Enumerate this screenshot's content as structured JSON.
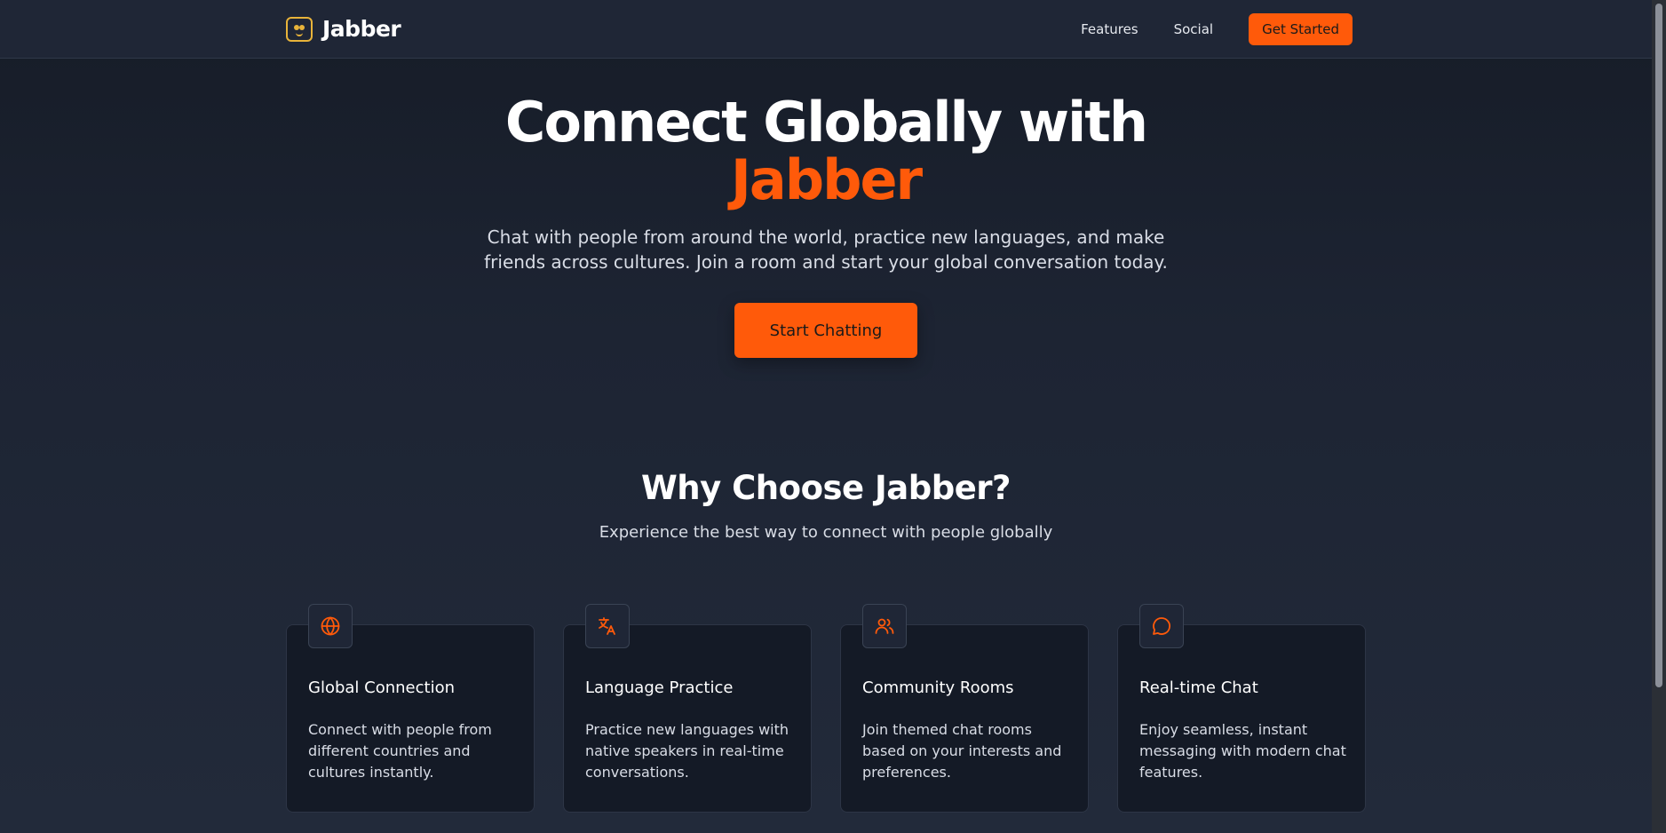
{
  "header": {
    "brand": "Jabber",
    "nav": [
      {
        "label": "Features"
      },
      {
        "label": "Social"
      }
    ],
    "cta_label": "Get Started"
  },
  "hero": {
    "title_line1": "Connect Globally with",
    "title_accent": "Jabber",
    "subtitle": "Chat with people from around the world, practice new languages, and make friends across cultures. Join a room and start your global conversation today.",
    "button_label": "Start Chatting"
  },
  "features": {
    "title": "Why Choose Jabber?",
    "subtitle": "Experience the best way to connect with people globally",
    "cards": [
      {
        "icon": "globe-icon",
        "title": "Global Connection",
        "description": "Connect with people from different countries and cultures instantly."
      },
      {
        "icon": "translate-icon",
        "title": "Language Practice",
        "description": "Practice new languages with native speakers in real-time conversations."
      },
      {
        "icon": "users-icon",
        "title": "Community Rooms",
        "description": "Join themed chat rooms based on your interests and preferences."
      },
      {
        "icon": "chat-bubble-icon",
        "title": "Real-time Chat",
        "description": "Enjoy seamless, instant messaging with modern chat features."
      }
    ]
  },
  "colors": {
    "accent": "#ff5a0a",
    "logo": "#e8b33a",
    "background": "#1c2331",
    "card": "#141a26"
  }
}
